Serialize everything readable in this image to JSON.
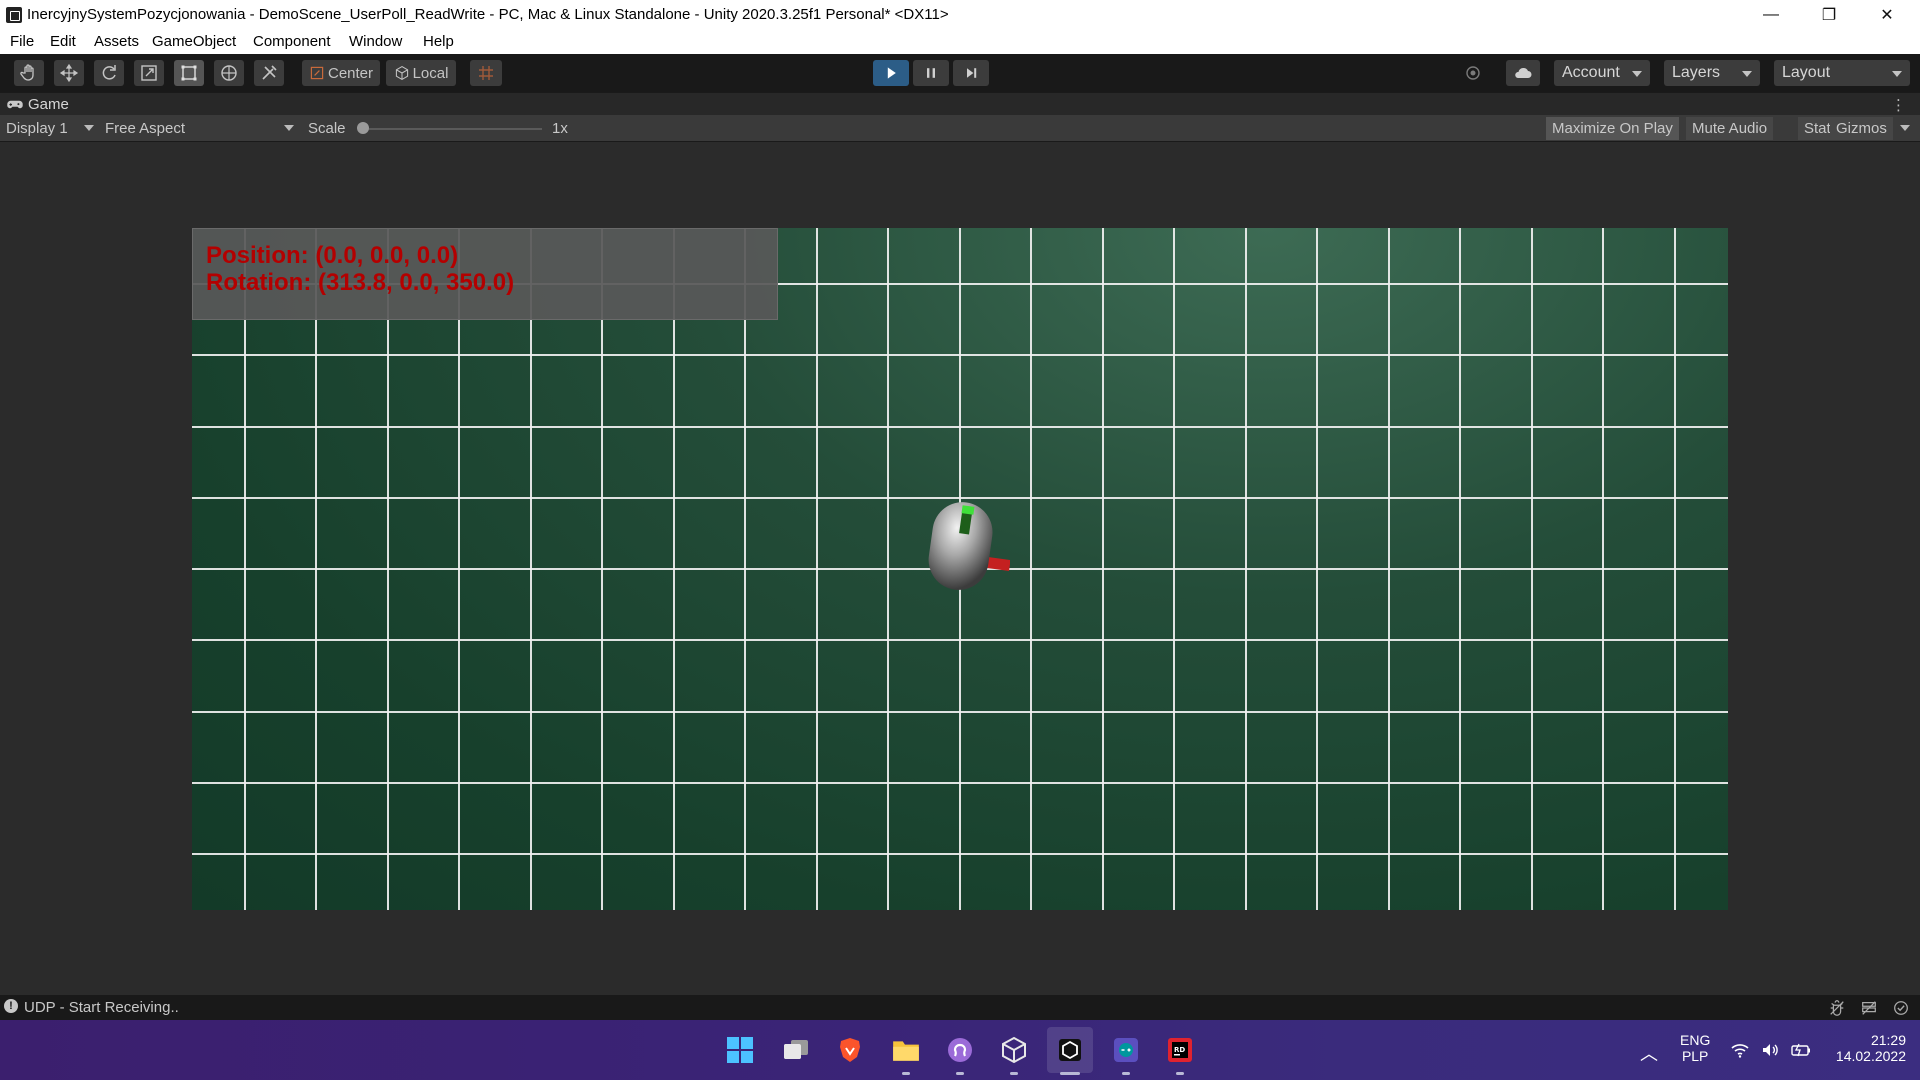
{
  "window": {
    "title": "InercyjnySystemPozycjonowania - DemoScene_UserPoll_ReadWrite - PC, Mac & Linux Standalone - Unity 2020.3.25f1 Personal* <DX11>",
    "controls": {
      "minimize": "—",
      "restore": "❐",
      "close": "✕"
    }
  },
  "menu": [
    "File",
    "Edit",
    "Assets",
    "GameObject",
    "Component",
    "Window",
    "Help"
  ],
  "toolbar": {
    "tools": [
      "hand-tool-icon",
      "move-tool-icon",
      "rotate-tool-icon",
      "scale-tool-icon",
      "rect-tool-icon",
      "transform-tool-icon",
      "custom-tool-icon"
    ],
    "pivot_label": "Center",
    "space_label": "Local",
    "account_label": "Account",
    "layers_label": "Layers",
    "layout_label": "Layout"
  },
  "game_tab": {
    "label": "Game"
  },
  "game_toolbar": {
    "display": "Display 1",
    "aspect": "Free Aspect",
    "scale_label": "Scale",
    "scale_value": "1x",
    "maximize_on_play": "Maximize On Play",
    "mute_audio": "Mute Audio",
    "stats": "Stats",
    "gizmos": "Gizmos"
  },
  "hud": {
    "position": "Position: (0.0, 0.0, 0.0)",
    "rotation": "Rotation: (313.8, 0.0, 350.0)"
  },
  "status": {
    "message": "UDP - Start Receiving.."
  },
  "taskbar": {
    "language": "ENG",
    "layout": "PLP",
    "time": "21:29",
    "date": "14.02.2022"
  },
  "colors": {
    "play_active": "#2c5d87",
    "hud_text": "#b40000",
    "taskbar": "#3a2477"
  }
}
